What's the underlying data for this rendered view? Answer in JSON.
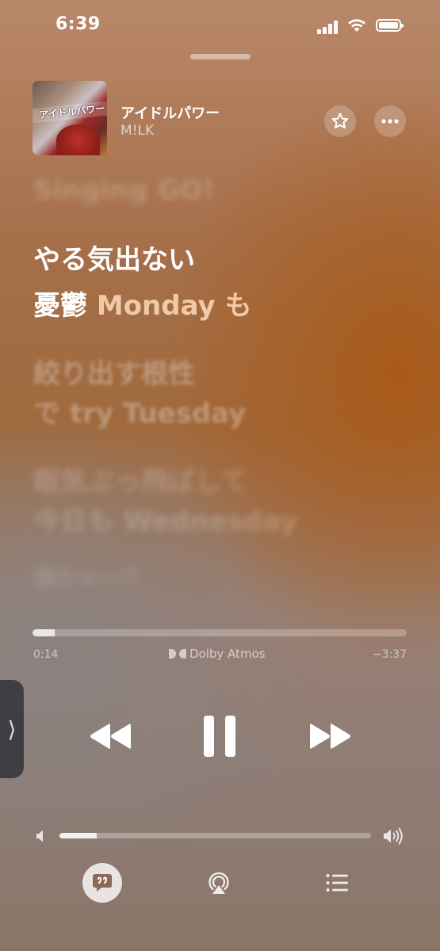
{
  "status_bar": {
    "time": "6:39"
  },
  "now_playing": {
    "title": "アイドルパワー",
    "artist": "M!LK",
    "album_art_text": "アイドルパワー"
  },
  "lyrics": {
    "previous": "Singing GO!",
    "current_line_1": "やる気出ない",
    "current_line_2_part_a": "憂鬱 ",
    "current_line_2_part_b": "Monday も",
    "next_1_line_1": "絞り出す根性",
    "next_1_line_2": "で try Tuesday",
    "next_2_line_1": "眠気ぶっ飛ばして",
    "next_2_line_2": "今日も Wednesday",
    "next_3": "頑ちゃって"
  },
  "playback": {
    "elapsed": "0:14",
    "remaining": "−3:37",
    "progress_fraction": 0.06,
    "audio_format": "Dolby Atmos"
  },
  "volume": {
    "level_fraction": 0.12
  },
  "colors": {
    "accent_highlight": "#f2c9a8"
  },
  "icons": [
    "star-icon",
    "more-icon",
    "rewind-icon",
    "pause-icon",
    "fast-forward-icon",
    "volume-low-icon",
    "volume-high-icon",
    "lyrics-icon",
    "airplay-icon",
    "queue-icon",
    "chevron-right-icon"
  ]
}
